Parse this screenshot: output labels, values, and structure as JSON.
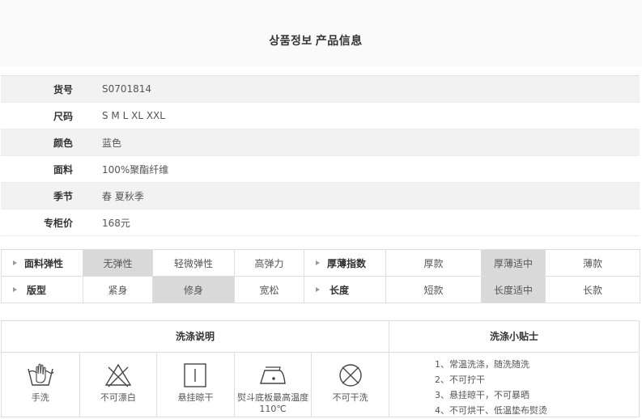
{
  "header": {
    "title_kr": "상품정보",
    "title_cn": "产品信息"
  },
  "info": [
    {
      "label": "货号",
      "value": "S0701814"
    },
    {
      "label": "尺码",
      "value": "S  M  L  XL  XXL"
    },
    {
      "label": "颜色",
      "value": "蓝色"
    },
    {
      "label": "面料",
      "value": "100%聚酯纤维"
    },
    {
      "label": "季节",
      "value": "春 夏秋季"
    },
    {
      "label": "专柜价",
      "value": "168元"
    }
  ],
  "attributes": {
    "row1": {
      "elastic_label": "面料弹性",
      "elastic_opts": [
        "无弹性",
        "轻微弹性",
        "高弹力"
      ],
      "elastic_selected": 0,
      "thick_label": "厚薄指数",
      "thick_opts": [
        "厚款",
        "厚薄适中",
        "薄款"
      ],
      "thick_selected": 1
    },
    "row2": {
      "fit_label": "版型",
      "fit_opts": [
        "紧身",
        "修身",
        "宽松"
      ],
      "fit_selected": 1,
      "length_label": "长度",
      "length_opts": [
        "短款",
        "长度适中",
        "长款"
      ],
      "length_selected": 1
    }
  },
  "care": {
    "title": "洗涤说明",
    "icons": [
      {
        "icon": "hand-wash-icon",
        "caption": "手洗"
      },
      {
        "icon": "no-bleach-icon",
        "caption": "不可漂白"
      },
      {
        "icon": "hang-dry-icon",
        "caption": "悬挂晾干"
      },
      {
        "icon": "iron-low-icon",
        "caption": "熨斗底板最高温度110℃"
      },
      {
        "icon": "no-dry-clean-icon",
        "caption": "不可干洗"
      }
    ]
  },
  "tips": {
    "title": "洗涤小贴士",
    "items": [
      "1、常温洗涤，随洗随洗",
      "2、不可拧干",
      "3、悬挂晾干，不可暴晒",
      "4、不可烘干、低温垫布熨烫"
    ]
  }
}
